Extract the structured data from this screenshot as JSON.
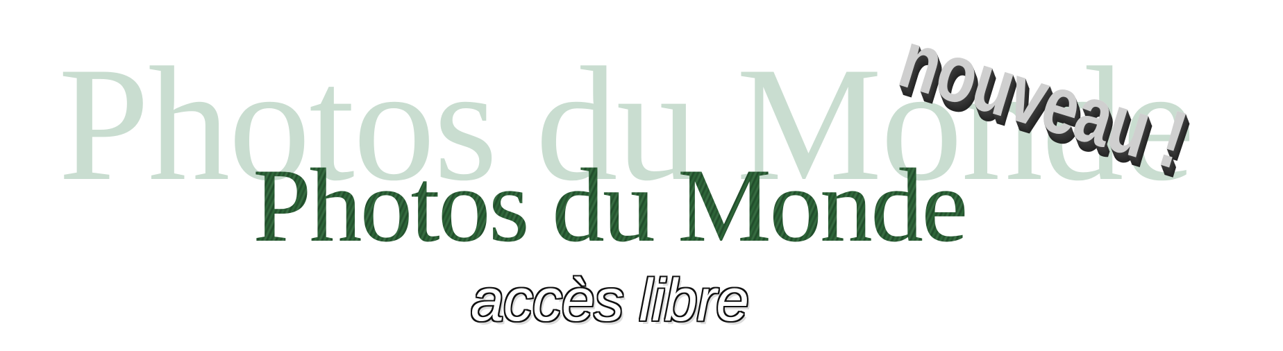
{
  "banner": {
    "background_title": "Photos du Monde",
    "main_title": "Photos du Monde",
    "subtitle": "accès libre",
    "badge": "nouveau !"
  },
  "colors": {
    "background": "#ffffff",
    "background_title": "#c9ddd0",
    "main_title": "#2b5a35",
    "subtitle_fill": "#ffffff",
    "subtitle_outline": "#111111",
    "badge_face": "#cfcfcf",
    "badge_side": "#333333"
  }
}
